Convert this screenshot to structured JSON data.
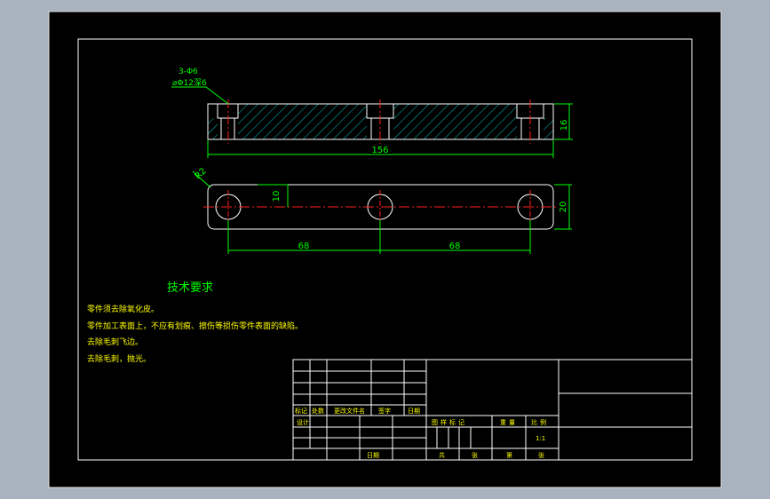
{
  "colors": {
    "background": "#a9b3bf",
    "paper": "#000000",
    "frame": "#ffffff",
    "geometry": "#ffffff",
    "dimension": "#00ff00",
    "centerline": "#ff2020",
    "hatch": "#00c0c0",
    "text_yellow": "#ffff00"
  },
  "drawing": {
    "leader": {
      "count": "3-Φ6",
      "counterbore": "⌀Φ12深6"
    },
    "dimensions": {
      "overall_length": "156",
      "thickness": "16",
      "radius": "R2",
      "height_top_hole": "10",
      "width": "20",
      "spacing_left": "68",
      "spacing_right": "68"
    }
  },
  "requirements": {
    "title": "技术要求",
    "items": [
      "零件须去除氧化皮。",
      "零件加工表面上，不应有划痕、擦伤等损伤零件表面的缺陷。",
      "去除毛刺飞边。",
      "去除毛刺，抛光。"
    ]
  },
  "title_block": {
    "rev_headers": [
      "标记",
      "处数",
      "更改文件名",
      "签字",
      "日期"
    ],
    "design": "设计",
    "date": "日期",
    "stage_headers": [
      "图样标记",
      "重量",
      "比例"
    ],
    "scale": "1:1",
    "sheet": [
      "共",
      "张",
      "第",
      "张"
    ]
  }
}
